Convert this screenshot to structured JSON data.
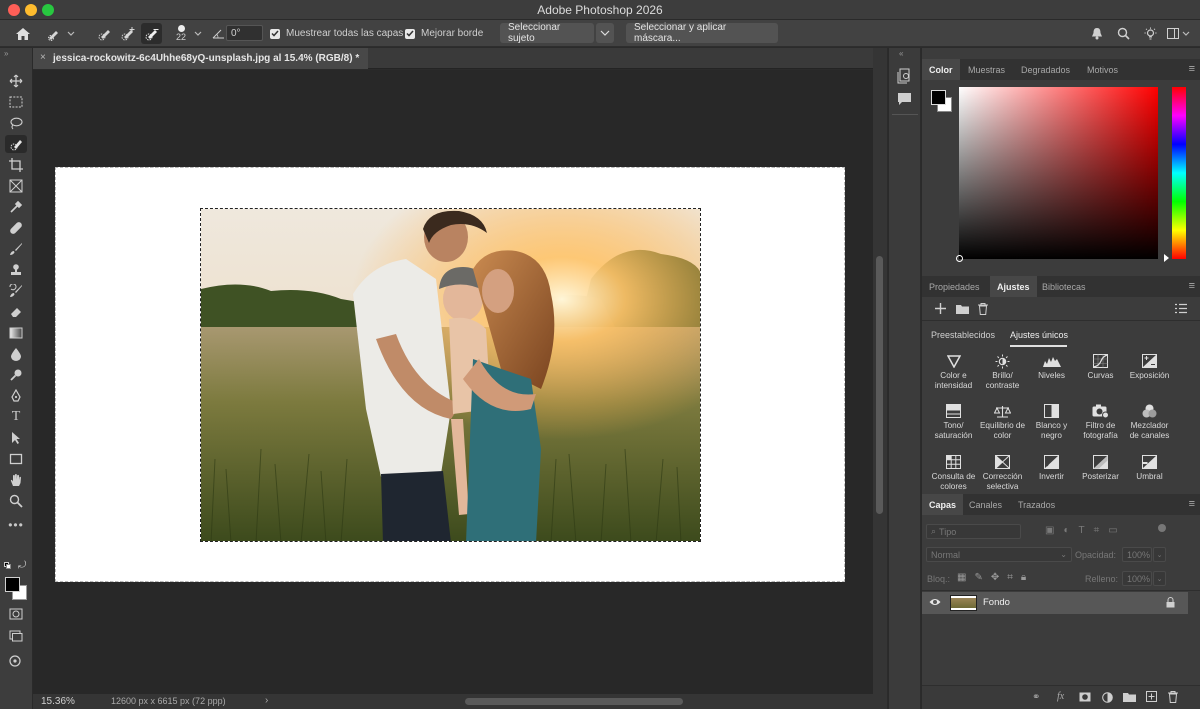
{
  "app": {
    "title": "Adobe Photoshop 2026"
  },
  "options_bar": {
    "brush_size": "22",
    "angle": "0°",
    "sample_all_layers": "Muestrear todas las capas",
    "enhance_edge": "Mejorar borde",
    "select_subject": "Seleccionar sujeto",
    "select_and_mask": "Seleccionar y aplicar máscara..."
  },
  "document": {
    "tab_label": "jessica-rockowitz-6c4Uhhe68yQ-unsplash.jpg al 15.4% (RGB/8) *"
  },
  "status_bar": {
    "zoom": "15.36%",
    "dimensions": "12600 px x 6615 px (72 ppp)"
  },
  "color_panel": {
    "tabs": [
      "Color",
      "Muestras",
      "Degradados",
      "Motivos"
    ],
    "active_tab": "Color",
    "foreground": "#000000",
    "background": "#ffffff",
    "hue_base": "#ff0000"
  },
  "adjustments_panel": {
    "tabs": [
      "Propiedades",
      "Ajustes",
      "Bibliotecas"
    ],
    "active_tab": "Ajustes",
    "subtabs": [
      "Preestablecidos",
      "Ajustes únicos"
    ],
    "active_subtab": "Ajustes únicos",
    "items": [
      {
        "label": "Color e intensidad",
        "icon": "color-intensity-icon"
      },
      {
        "label": "Brillo/ contraste",
        "icon": "brightness-contrast-icon"
      },
      {
        "label": "Niveles",
        "icon": "levels-icon"
      },
      {
        "label": "Curvas",
        "icon": "curves-icon"
      },
      {
        "label": "Exposición",
        "icon": "exposure-icon"
      },
      {
        "label": "Tono/ saturación",
        "icon": "hue-saturation-icon"
      },
      {
        "label": "Equilibrio de color",
        "icon": "color-balance-icon"
      },
      {
        "label": "Blanco y negro",
        "icon": "black-white-icon"
      },
      {
        "label": "Filtro de fotografía",
        "icon": "photo-filter-icon"
      },
      {
        "label": "Mezclador de canales",
        "icon": "channel-mixer-icon"
      },
      {
        "label": "Consulta de colores",
        "icon": "color-lookup-icon"
      },
      {
        "label": "Corrección selectiva",
        "icon": "selective-color-icon"
      },
      {
        "label": "Invertir",
        "icon": "invert-icon"
      },
      {
        "label": "Posterizar",
        "icon": "posterize-icon"
      },
      {
        "label": "Umbral",
        "icon": "threshold-icon"
      }
    ]
  },
  "layers_panel": {
    "tabs": [
      "Capas",
      "Canales",
      "Trazados"
    ],
    "active_tab": "Capas",
    "filter_placeholder": "Tipo",
    "blend_mode": "Normal",
    "opacity_label": "Opacidad:",
    "opacity_value": "100%",
    "lock_label": "Bloq.:",
    "fill_label": "Relleno:",
    "fill_value": "100%",
    "layers": [
      {
        "name": "Fondo",
        "locked": true,
        "visible": true
      }
    ]
  }
}
